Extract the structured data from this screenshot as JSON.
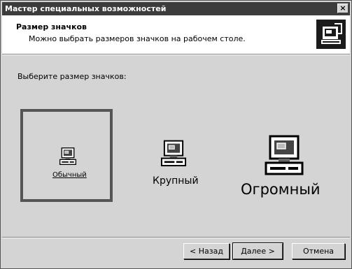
{
  "window": {
    "title": "Мастер специальных возможностей",
    "close_glyph": "×"
  },
  "header": {
    "title": "Размер значков",
    "subtitle": "Можно выбрать размеров значков на рабочем столе.",
    "icon": "wizard-icon"
  },
  "prompt": "Выберите размер значков:",
  "options": [
    {
      "label": "Обычный",
      "icon": "computer-icon",
      "selected": true
    },
    {
      "label": "Крупный",
      "icon": "computer-icon",
      "selected": false
    },
    {
      "label": "Огромный",
      "icon": "computer-icon",
      "selected": false
    }
  ],
  "buttons": {
    "back": "< Назад",
    "next": "Далее >",
    "cancel": "Отмена"
  }
}
